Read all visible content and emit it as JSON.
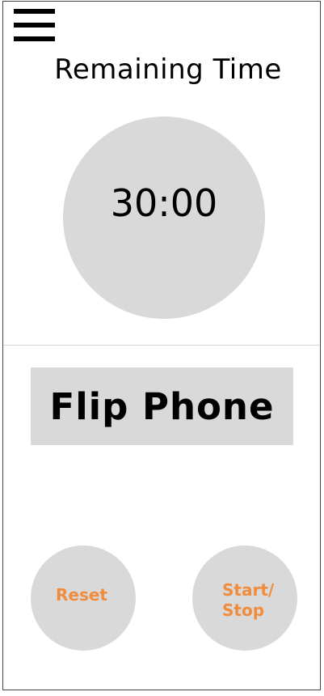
{
  "header": {
    "menu_icon": "hamburger-menu-icon",
    "title": "Remaining Time"
  },
  "timer": {
    "display": "30:00"
  },
  "instruction": {
    "label": "Flip Phone"
  },
  "controls": {
    "reset_label": "Reset",
    "start_stop_label": "Start/\nStop"
  },
  "colors": {
    "circle_fill": "#d9d9d9",
    "button_text": "#f08c3c"
  }
}
